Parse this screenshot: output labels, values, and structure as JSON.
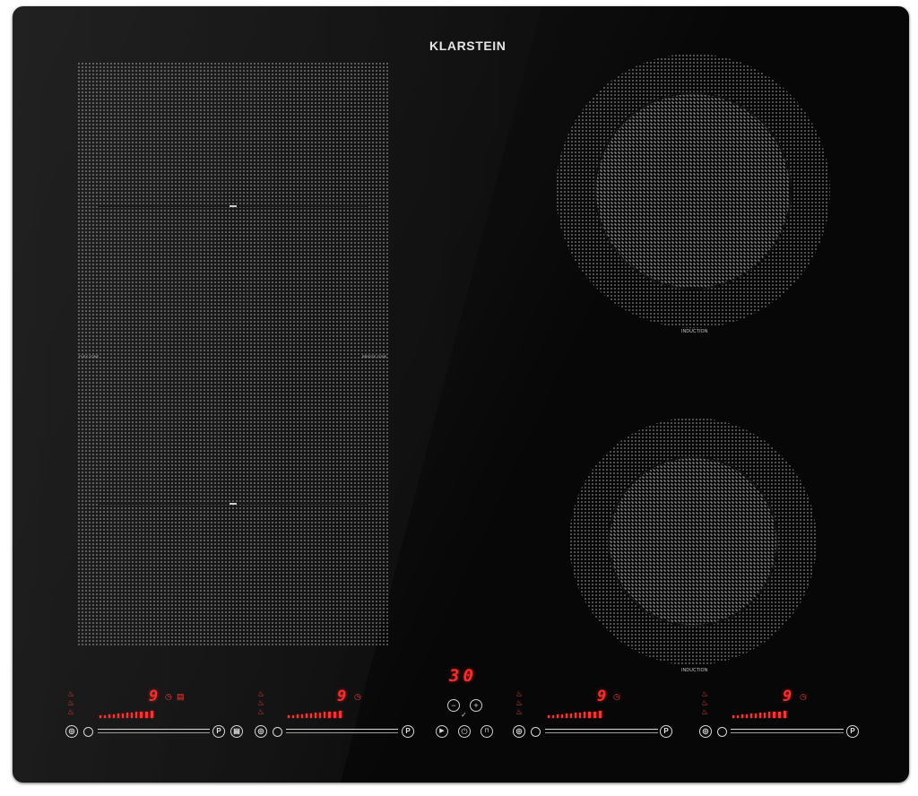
{
  "brand": {
    "name": "KLARSTEIN"
  },
  "zones": {
    "flex": {
      "label_left": "FLEX ZONE",
      "label_right": "BRIDGE ZONE"
    },
    "right_top": {
      "label": "INDUCTION"
    },
    "right_bottom": {
      "label": "INDUCTION"
    }
  },
  "controls": {
    "timer_display": "30",
    "minus_label": "−",
    "plus_label": "+",
    "play_label": "▶",
    "power_label": "⏻",
    "lock_label": "🔒",
    "zone_panels": [
      {
        "level": "9",
        "timer_icon": "clock-icon",
        "extra_icon": "flex-icon",
        "p_label": "P",
        "bars": 12
      },
      {
        "level": "9",
        "timer_icon": "clock-icon",
        "p_label": "P",
        "bars": 12
      },
      {
        "level": "9",
        "timer_icon": "clock-icon",
        "p_label": "P",
        "bars": 12
      },
      {
        "level": "9",
        "timer_icon": "clock-icon",
        "p_label": "P",
        "bars": 12
      }
    ],
    "accent_color": "#ff2b2b",
    "panel_color": "#070707"
  }
}
